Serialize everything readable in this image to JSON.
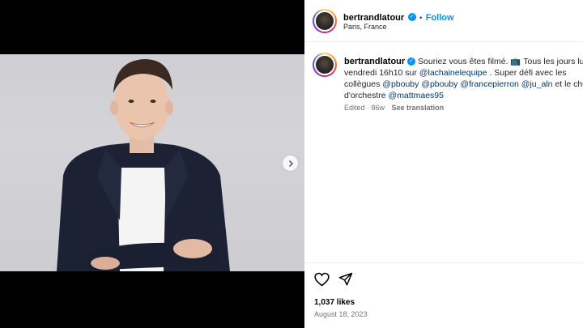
{
  "post": {
    "username": "bertrandlatour",
    "follow_label": "Follow",
    "location": "Paris, France",
    "dot": "•"
  },
  "caption": {
    "username": "bertrandlatour",
    "line1_text": " Souriez vous êtes filmé. ",
    "tv_emoji": "📺",
    "line1_rest": " Tous les jours lund",
    "line2_prefix": "vendredi 16h10 sur ",
    "mention_1": "@lachainelequipe",
    "line2_suffix": " . Super défi avec les",
    "line3_prefix": "collègues ",
    "mention_2": "@pbouby",
    "mention_3": "@pbouby",
    "mention_4": "@francepierron",
    "mention_5": "@ju_aln",
    "line3_suffix": " et le chef",
    "line4_prefix": "d'orchestre ",
    "mention_6": "@mattmaes95",
    "edited": "Edited · 86w",
    "see_translation": "See translation"
  },
  "stats": {
    "likes": "1,037 likes",
    "date": "August 18, 2023"
  },
  "icons": {
    "verified": "verified-badge-icon",
    "heart": "heart-icon",
    "share": "share-icon",
    "next": "chevron-right-icon"
  },
  "colors": {
    "link_blue": "#0095f6",
    "mention": "#00376b"
  }
}
